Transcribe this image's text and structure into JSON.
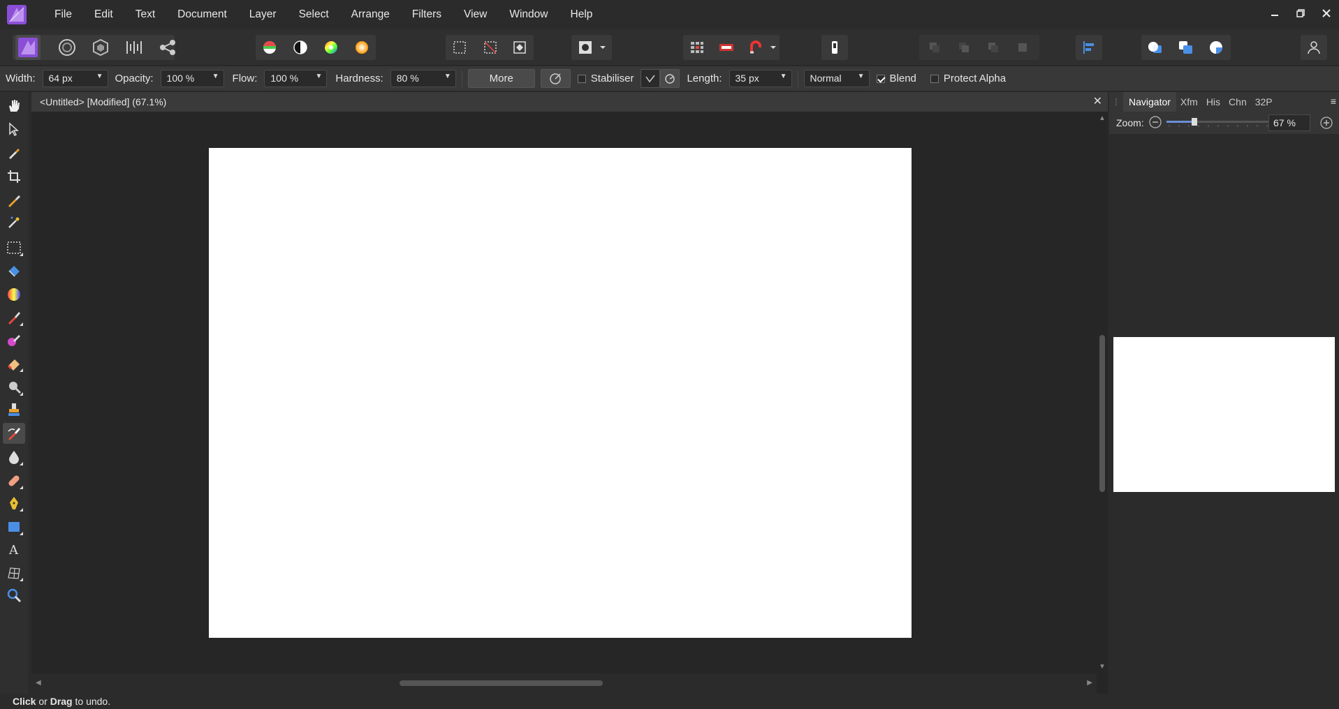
{
  "menu": {
    "items": [
      "File",
      "Edit",
      "Text",
      "Document",
      "Layer",
      "Select",
      "Arrange",
      "Filters",
      "View",
      "Window",
      "Help"
    ]
  },
  "context": {
    "width_label": "Width:",
    "width_value": "64 px",
    "opacity_label": "Opacity:",
    "opacity_value": "100 %",
    "flow_label": "Flow:",
    "flow_value": "100 %",
    "hardness_label": "Hardness:",
    "hardness_value": "80 %",
    "more_label": "More",
    "stabiliser_label": "Stabiliser",
    "length_label": "Length:",
    "length_value": "35 px",
    "blend_mode": "Normal",
    "blend_label": "Blend",
    "protect_alpha_label": "Protect Alpha"
  },
  "document": {
    "tab_title": "<Untitled> [Modified] (67.1%)",
    "canvas_color": "#ffffff"
  },
  "panel": {
    "tabs": [
      "Navigator",
      "Xfm",
      "His",
      "Chn",
      "32P"
    ],
    "zoom_label": "Zoom:",
    "zoom_value": "67 %",
    "zoom_level": 0.67
  },
  "status": {
    "click": "Click",
    "or": "or",
    "drag": "Drag",
    "rest": "to undo."
  },
  "colors": {
    "accent": "#6b8fd6",
    "app_bg": "#2b2b2b"
  }
}
